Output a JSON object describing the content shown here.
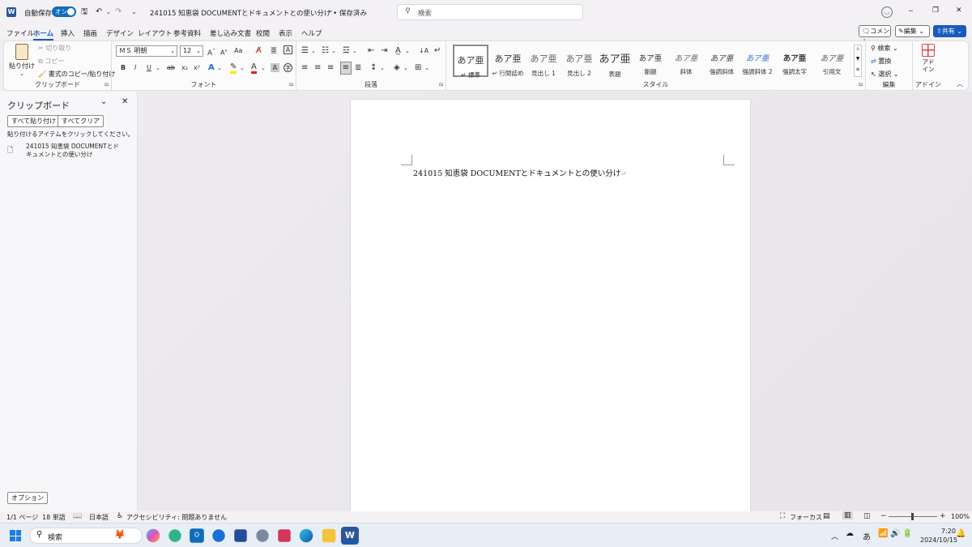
{
  "titlebar": {
    "autosave_label": "自動保存",
    "autosave_toggle": "オン",
    "doc_title": "241015  知恵袋  DOCUMENTとドキュメントとの使い分け • 保存済み",
    "title_chevron": "⌄",
    "search_placeholder": "検索",
    "min": "─",
    "restore": "❐",
    "close": "✕"
  },
  "menu": {
    "items": [
      "ファイル",
      "ホーム",
      "挿入",
      "描画",
      "デザイン",
      "レイアウト",
      "参考資料",
      "差し込み文書",
      "校閲",
      "表示",
      "ヘルプ"
    ],
    "comment": "コメント",
    "edit": "編集",
    "share": "共有"
  },
  "ribbon": {
    "clipboard": {
      "paste": "貼り付け",
      "cut": "切り取り",
      "copy": "コピー",
      "format_painter": "書式のコピー/貼り付け",
      "label": "クリップボード"
    },
    "font": {
      "font_name": "ＭＳ 明朝",
      "font_size": "12",
      "label": "フォント",
      "aa": "Aa",
      "bold": "B",
      "italic": "I",
      "underline": "U",
      "strike": "ab",
      "sub": "x₂",
      "sup": "x²"
    },
    "paragraph": {
      "label": "段落"
    },
    "styles": {
      "label": "スタイル",
      "items": [
        {
          "sample": "あア亜",
          "name": "標準"
        },
        {
          "sample": "あア亜",
          "name": "行間詰め"
        },
        {
          "sample": "あア亜",
          "name": "見出し 1"
        },
        {
          "sample": "あア亜",
          "name": "見出し 2"
        },
        {
          "sample": "あア亜",
          "name": "表題"
        },
        {
          "sample": "あア亜",
          "name": "副題"
        },
        {
          "sample": "あア亜",
          "name": "斜体"
        },
        {
          "sample": "あア亜",
          "name": "強調斜体"
        },
        {
          "sample": "あア亜",
          "name": "強調斜体 2"
        },
        {
          "sample": "あア亜",
          "name": "強調太字"
        },
        {
          "sample": "あア亜",
          "name": "引用文"
        }
      ]
    },
    "editing": {
      "find": "検索",
      "replace": "置換",
      "select": "選択",
      "label": "編集"
    },
    "addins": {
      "name": "アド\nイン",
      "label": "アドイン"
    }
  },
  "clipboard_pane": {
    "title": "クリップボード",
    "paste_all": "すべて貼り付け",
    "clear_all": "すべてクリア",
    "hint": "貼り付けるアイテムをクリックしてください。",
    "item_line1": "241015 知恵袋 DOCUMENTとド",
    "item_line2": "キュメントとの使い分け",
    "options": "オプション"
  },
  "document": {
    "text": "241015  知恵袋  DOCUMENTとドキュメントとの使い分け"
  },
  "status": {
    "page": "1/1 ページ",
    "words": "18 単語",
    "lang": "日本語",
    "accessibility": "アクセシビリティ: 問題ありません",
    "focus": "フォーカス",
    "zoom": "100%"
  },
  "taskbar": {
    "search": "検索",
    "ime": "あ",
    "time": "7:20",
    "date": "2024/10/15"
  },
  "colors": {
    "accent": "#185abd",
    "toggle": "#0f6cbd",
    "word_blue": "#2b579a"
  }
}
